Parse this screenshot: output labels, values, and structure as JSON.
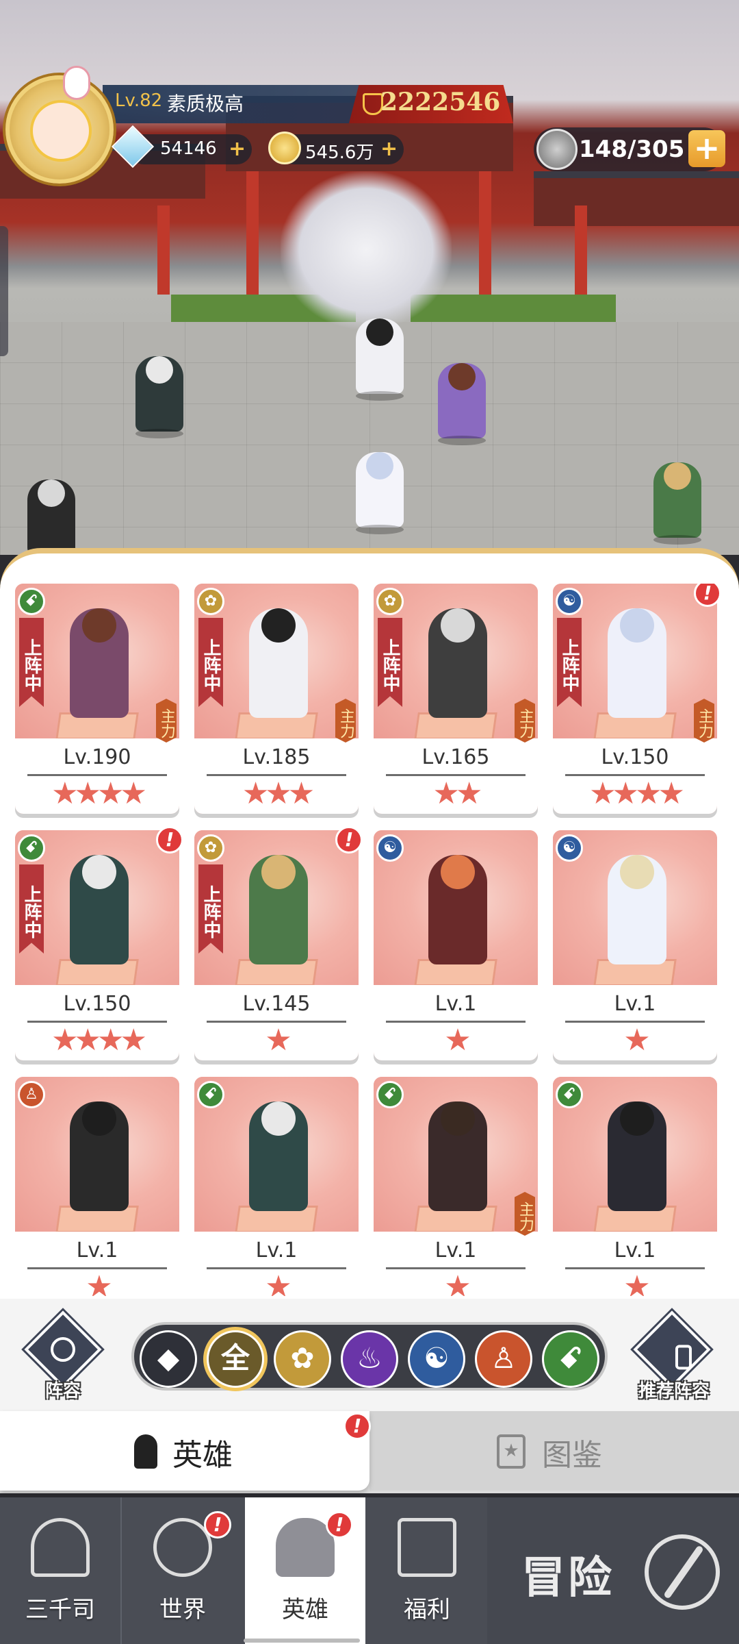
{
  "player": {
    "level": "Lv.82",
    "title": "素质极高",
    "power": "2222546"
  },
  "resources": {
    "diamonds": "54146",
    "gold": "545.6万",
    "energy": "148/305"
  },
  "colors": {
    "card": "#f3a9a1",
    "star": "#e7685a",
    "deploy": "#b5363a",
    "alert": "#e03a3a",
    "nav": "#4a4d55"
  },
  "cards": [
    {
      "level": "Lv.190",
      "stars": "★★★★",
      "faction": "green",
      "faction_icon": "dna-icon",
      "deploy": "上阵中",
      "main": "主力",
      "alert": ""
    },
    {
      "level": "Lv.185",
      "stars": "★★★",
      "faction": "gold",
      "faction_icon": "lotus-icon",
      "deploy": "上阵中",
      "main": "主力",
      "alert": ""
    },
    {
      "level": "Lv.165",
      "stars": "★★",
      "faction": "gold",
      "faction_icon": "lotus-icon",
      "deploy": "上阵中",
      "main": "主力",
      "alert": ""
    },
    {
      "level": "Lv.150",
      "stars": "★★★★",
      "faction": "blue",
      "faction_icon": "yinyang-icon",
      "deploy": "上阵中",
      "main": "主力",
      "alert": "!"
    },
    {
      "level": "Lv.150",
      "stars": "★★★★",
      "faction": "green",
      "faction_icon": "dna-icon",
      "deploy": "上阵中",
      "main": "",
      "alert": "!"
    },
    {
      "level": "Lv.145",
      "stars": "★",
      "faction": "gold",
      "faction_icon": "lotus-icon",
      "deploy": "上阵中",
      "main": "",
      "alert": "!"
    },
    {
      "level": "Lv.1",
      "stars": "★",
      "faction": "blue",
      "faction_icon": "yinyang-icon",
      "deploy": "",
      "main": "",
      "alert": ""
    },
    {
      "level": "Lv.1",
      "stars": "★",
      "faction": "blue",
      "faction_icon": "yinyang-icon",
      "deploy": "",
      "main": "",
      "alert": ""
    },
    {
      "level": "Lv.1",
      "stars": "★",
      "faction": "orange",
      "faction_icon": "meditation-icon",
      "deploy": "",
      "main": "",
      "alert": ""
    },
    {
      "level": "Lv.1",
      "stars": "★",
      "faction": "green",
      "faction_icon": "dna-icon",
      "deploy": "",
      "main": "",
      "alert": ""
    },
    {
      "level": "Lv.1",
      "stars": "★",
      "faction": "green",
      "faction_icon": "dna-icon",
      "deploy": "",
      "main": "主力",
      "alert": ""
    },
    {
      "level": "Lv.1",
      "stars": "★",
      "faction": "green",
      "faction_icon": "dna-icon",
      "deploy": "",
      "main": "",
      "alert": ""
    }
  ],
  "filter_bar": {
    "squad_label": "阵容",
    "recommend_label": "推荐阵容",
    "filters": [
      {
        "icon": "diamonds-icon",
        "text": "",
        "color": "#2e3038",
        "selected": false
      },
      {
        "icon": "all-icon",
        "text": "全",
        "color": "#6a5a2a",
        "selected": true
      },
      {
        "icon": "lotus-icon",
        "text": "",
        "color": "#c29a3a",
        "selected": false
      },
      {
        "icon": "flame-icon",
        "text": "",
        "color": "#6a35a8",
        "selected": false
      },
      {
        "icon": "yinyang-icon",
        "text": "",
        "color": "#2f5c9e",
        "selected": false
      },
      {
        "icon": "meditation-icon",
        "text": "",
        "color": "#c9542d",
        "selected": false
      },
      {
        "icon": "dna-icon",
        "text": "",
        "color": "#3f8a3a",
        "selected": false
      }
    ]
  },
  "tabs": {
    "hero": "英雄",
    "codex": "图鉴",
    "hero_alert": "!"
  },
  "nav": {
    "items": [
      {
        "label": "三千司",
        "icon": "temple-icon",
        "alert": ""
      },
      {
        "label": "世界",
        "icon": "planet-icon",
        "alert": "!"
      },
      {
        "label": "英雄",
        "icon": "hero-silhouette-icon",
        "alert": "!"
      },
      {
        "label": "福利",
        "icon": "gift-box-icon",
        "alert": ""
      }
    ],
    "adventure": "冒险"
  }
}
